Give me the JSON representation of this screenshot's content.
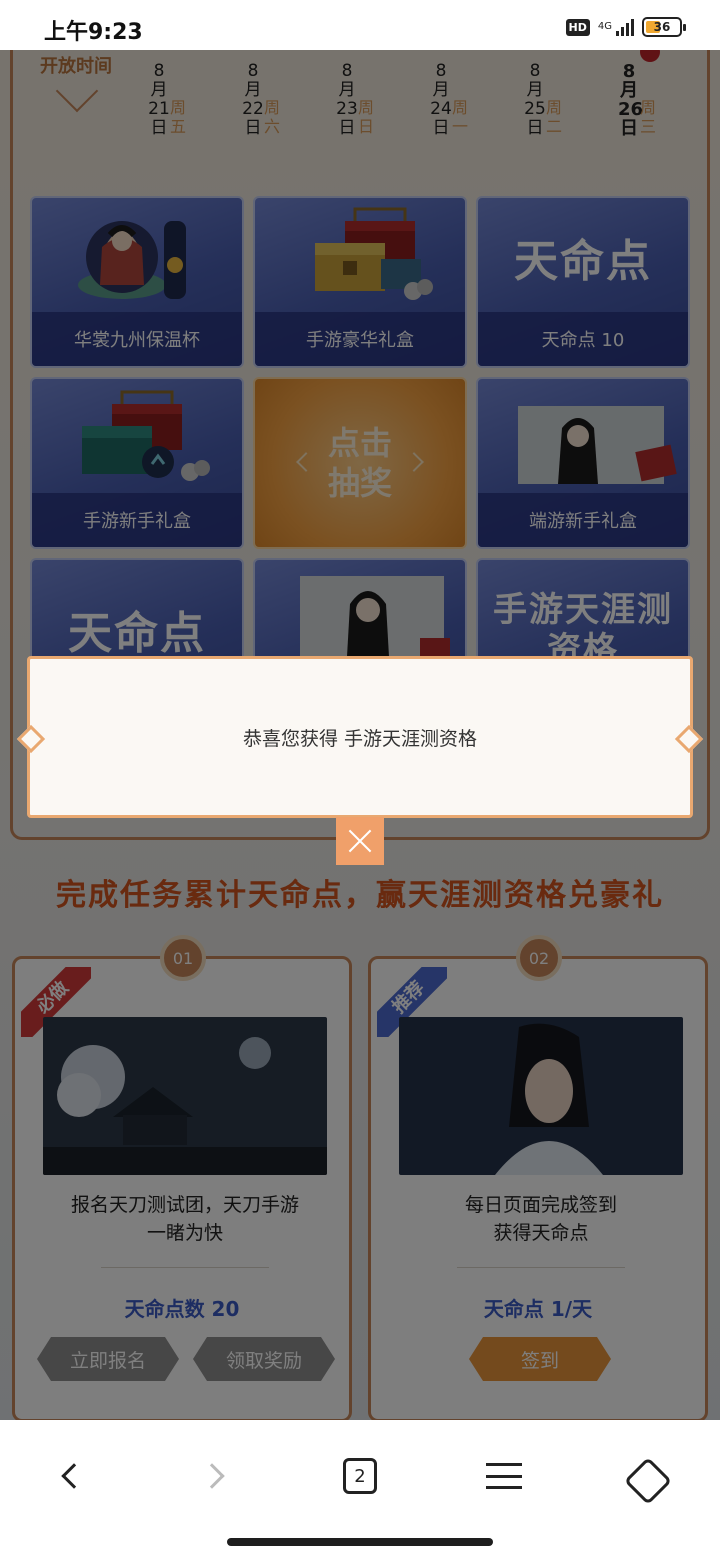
{
  "status_bar": {
    "time": "上午9:23",
    "hd": "HD",
    "network": "4G",
    "battery": "36"
  },
  "schedule": {
    "title": "开放时间",
    "dates": [
      {
        "month": "8",
        "m": "月",
        "day": "21",
        "d": "日",
        "weekday": "周五"
      },
      {
        "month": "8",
        "m": "月",
        "day": "22",
        "d": "日",
        "weekday": "周六"
      },
      {
        "month": "8",
        "m": "月",
        "day": "23",
        "d": "日",
        "weekday": "周日"
      },
      {
        "month": "8",
        "m": "月",
        "day": "24",
        "d": "日",
        "weekday": "周一"
      },
      {
        "month": "8",
        "m": "月",
        "day": "25",
        "d": "日",
        "weekday": "周二"
      },
      {
        "month": "8",
        "m": "月",
        "day": "26",
        "d": "日",
        "weekday": "周三"
      }
    ]
  },
  "prizes": [
    {
      "label": "华裳九州保温杯",
      "art": "thermos-cup-icon"
    },
    {
      "label": "手游豪华礼盒",
      "art": "treasure-chest-icon"
    },
    {
      "label": "天命点 10",
      "art_text": "天命点"
    },
    {
      "label": "手游新手礼盒",
      "art": "gift-box-icon"
    },
    {
      "label": "端游新手礼盒",
      "art": "portrait-icon"
    },
    {
      "art_text": "天命点"
    },
    {
      "art": "portrait-icon"
    },
    {
      "art_text": "手游天涯测资格"
    }
  ],
  "draw_button": {
    "line1": "点击",
    "line2": "抽奖"
  },
  "tasks_section": {
    "title": "完成任务累计天命点，赢天涯测资格兑豪礼",
    "tasks": [
      {
        "num": "01",
        "ribbon": "必做",
        "desc_line1": "报名天刀测试团，天刀手游",
        "desc_line2": "一睹为快",
        "points": "天命点数 20",
        "buttons": [
          "立即报名",
          "领取奖励"
        ]
      },
      {
        "num": "02",
        "ribbon": "推荐",
        "desc_line1": "每日页面完成签到",
        "desc_line2": "获得天命点",
        "points": "天命点 1/天",
        "buttons": [
          "签到"
        ]
      }
    ]
  },
  "modal": {
    "message": "恭喜您获得 手游天涯测资格"
  },
  "bottom_nav": {
    "tab_count": "2"
  },
  "colors": {
    "accent": "#c6875a",
    "task_title": "#d2541f",
    "points": "#3b5bc4",
    "prize_bg": "#4a5fb2"
  }
}
